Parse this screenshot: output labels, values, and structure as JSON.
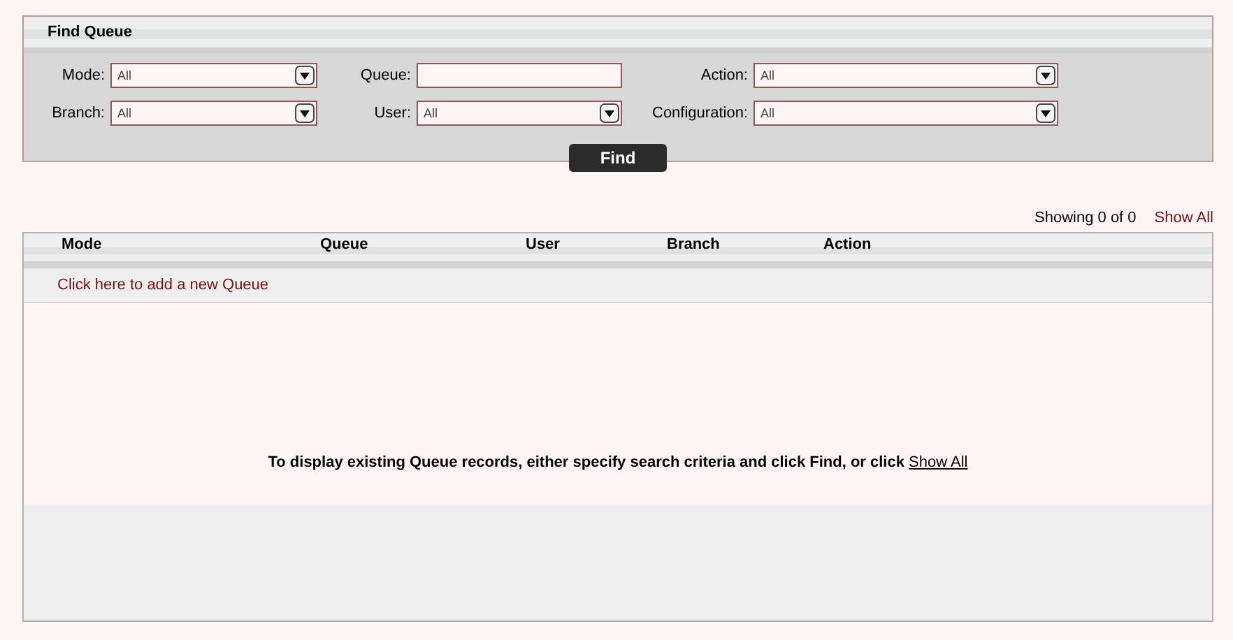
{
  "find_panel": {
    "title": "Find Queue",
    "fields": [
      {
        "label": "Mode:",
        "kind": "select",
        "value": "All"
      },
      {
        "label": "Queue:",
        "kind": "text"
      },
      {
        "label": "Action:",
        "kind": "select",
        "value": "All"
      },
      {
        "label": "Branch:",
        "kind": "select",
        "value": "All"
      },
      {
        "label": "User:",
        "kind": "select",
        "value": "All"
      },
      {
        "label": "Configuration:",
        "kind": "select",
        "value": "All"
      }
    ],
    "button": "Find"
  },
  "results": {
    "count": "Showing 0 of 0",
    "show_all": "Show All",
    "columns": [
      "Mode",
      "Queue",
      "User",
      "Branch",
      "Action"
    ],
    "add_link": "Click here to add a new Queue",
    "empty_message": {
      "text": "To display existing Queue records, either specify search criteria and click Find, or click",
      "link": "Show All"
    }
  }
}
